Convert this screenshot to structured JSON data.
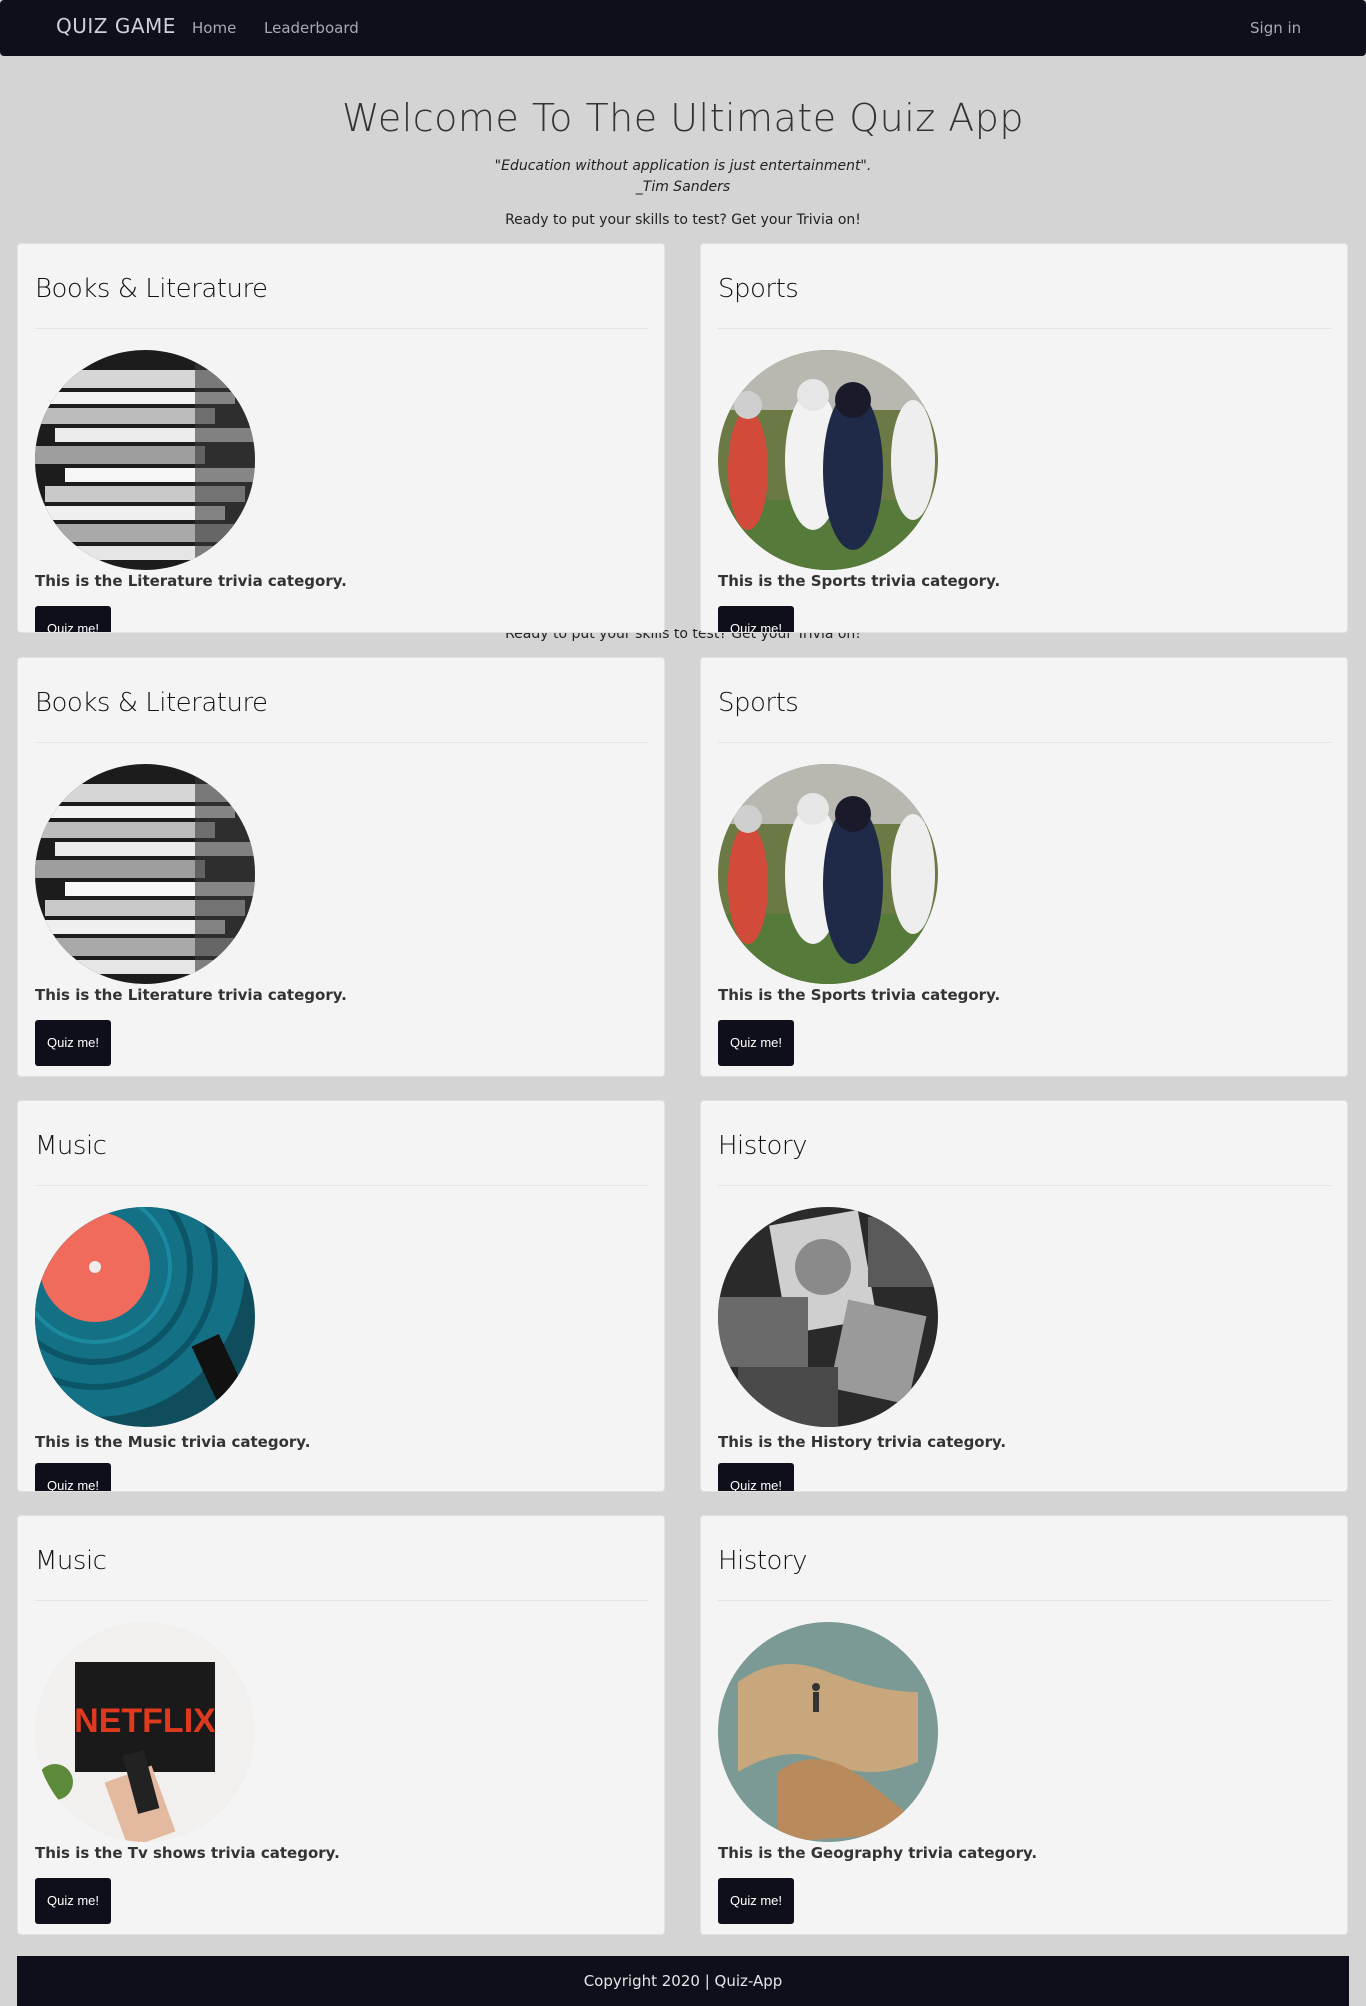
{
  "navbar": {
    "brand": "QUIZ GAME",
    "home": "Home",
    "leaderboard": "Leaderboard",
    "signin": "Sign in"
  },
  "hero": {
    "title": "Welcome To The Ultimate Quiz App",
    "quote": "\"Education without application is just entertainment\".",
    "author": "_Tim Sanders",
    "tagline": "Ready to put your skills to test? Get your Trivia on!"
  },
  "cards": [
    {
      "title": "Books & Literature",
      "text": "This is the Literature trivia category.",
      "button": "Quiz me!",
      "image": "books-image"
    },
    {
      "title": "Sports",
      "text": "This is the Sports trivia category.",
      "button": "Quiz me!",
      "image": "football-image"
    },
    {
      "title": "Books & Literature",
      "text": "This is the Literature trivia category.",
      "button": "Quiz me!",
      "image": "books-image"
    },
    {
      "title": "Sports",
      "text": "This is the Sports trivia category.",
      "button": "Quiz me!",
      "image": "football-image"
    },
    {
      "title": "Music",
      "text": "This is the Music trivia category.",
      "button": "Quiz me!",
      "image": "vinyl-record-image"
    },
    {
      "title": "History",
      "text": "This is the History trivia category.",
      "button": "Quiz me!",
      "image": "old-photos-image"
    },
    {
      "title": "Music",
      "text": "This is the Tv shows trivia category.",
      "button": "Quiz me!",
      "image": "netflix-tv-image"
    },
    {
      "title": "History",
      "text": "This is the Geography trivia category.",
      "button": "Quiz me!",
      "image": "globe-map-image"
    }
  ],
  "footer": {
    "copyright": "Copyright 2020 | Quiz-App"
  }
}
